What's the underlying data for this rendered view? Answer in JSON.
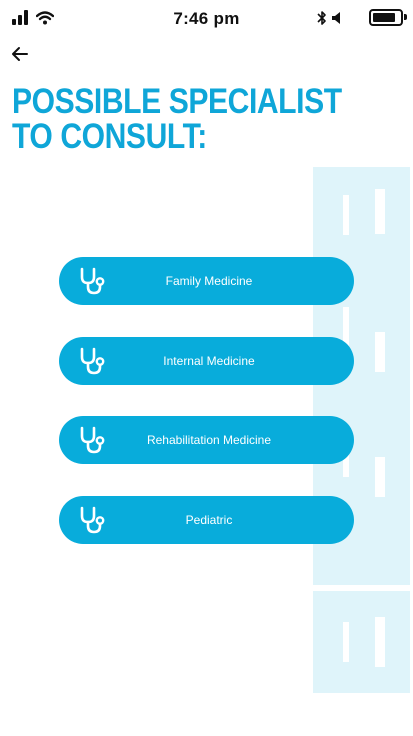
{
  "status_bar": {
    "time": "7:46 pm",
    "icons": [
      "cellular-signal-icon",
      "wifi-icon",
      "bluetooth-icon",
      "mute-icon",
      "battery-icon"
    ],
    "battery_level": 0.85
  },
  "header": {
    "back_icon": "back-arrow-icon",
    "title_line1": "POSSIBLE SPECIALIST",
    "title_line2": "TO CONSULT:"
  },
  "specialists": [
    {
      "label": "Family Medicine",
      "icon": "stethoscope-icon"
    },
    {
      "label": "Internal Medicine",
      "icon": "stethoscope-icon"
    },
    {
      "label": "Rehabilitation Medicine",
      "icon": "stethoscope-icon"
    },
    {
      "label": "Pediatric",
      "icon": "stethoscope-icon"
    }
  ],
  "colors": {
    "accent": "#0fa6d8",
    "button": "#08acdb",
    "decor": "#dff4fa"
  }
}
